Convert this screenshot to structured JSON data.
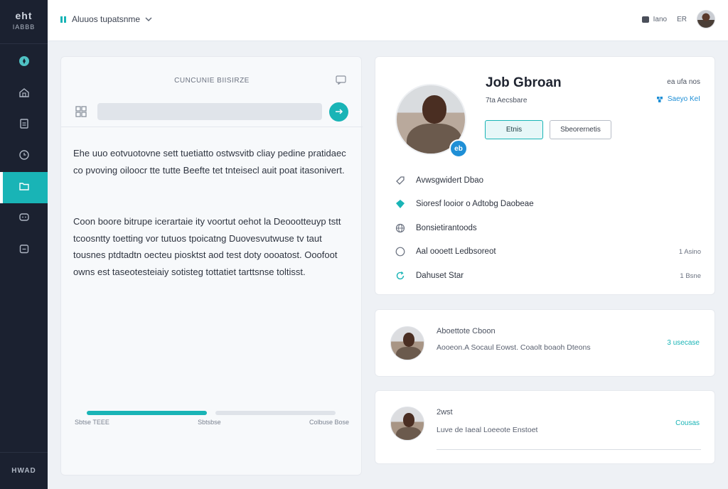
{
  "sidebar": {
    "brand_top": "eht",
    "brand_bottom": "IABBB",
    "items": [
      {
        "icon": "compass-icon",
        "active": false
      },
      {
        "icon": "home-icon",
        "active": false
      },
      {
        "icon": "document-icon",
        "active": false
      },
      {
        "icon": "clock-icon",
        "active": false
      },
      {
        "icon": "folder-icon",
        "active": true
      },
      {
        "icon": "chat-icon",
        "active": false
      },
      {
        "icon": "calendar-icon",
        "active": false
      }
    ],
    "footer_label": "HWAD"
  },
  "header": {
    "workspace_label": "Aluuos tupatsnme",
    "status_text": "Iano",
    "lang": "ER"
  },
  "left_panel": {
    "title": "CUNCUNIE BIISIRZE",
    "search_placeholder": "",
    "paragraph1": "Ehe uuo eotvuotovne sett tuetiatto ostwsvitb cliay pedine pratidaec co pvoving oiloocr tte tutte Beefte tet tnteisecl auit poat itasonivert.",
    "paragraph2": "Coon boore bitrupe icerartaie ity voortut oehot la Deoootteuyp tstt tcoosntty toetting vor tutuos tpoicatng Duovesvutwuse tv taut tousnes ptdtadtn oecteu piosktst aod test doty oooatost. Ooofoot owns est taseotesteiaiy sotisteg tottatiet tarttsnse toltisst.",
    "progress_fraction": 0.5,
    "progress_labels": [
      "Sbtse TEEE",
      "Sbtsbse",
      "Colbuse Bose"
    ]
  },
  "profile": {
    "name": "Job Gbroan",
    "subtitle": "7ta Aecsbare",
    "meta_right": "ea ufa nos",
    "link_text": "Saeyo KeI",
    "badge_text": "eb",
    "primary_button": "Etnis",
    "secondary_button": "Sbeorernetis",
    "details": [
      {
        "icon": "tag-icon",
        "text": "Avwsgwidert Dbao",
        "meta": ""
      },
      {
        "icon": "diamond-icon",
        "text": "Sioresf looior o Adtobg Daobeae",
        "meta": ""
      },
      {
        "icon": "globe-icon",
        "text": "Bonsietirantoods",
        "meta": ""
      },
      {
        "icon": "info-icon",
        "text": "Aal oooett Ledbsoreot",
        "meta": "1 Asino"
      },
      {
        "icon": "refresh-icon",
        "text": "Dahuset Star",
        "meta": "1 Bsne"
      }
    ]
  },
  "messages": [
    {
      "title": "Aboettote Cboon",
      "text": "Aooeon.A Socaul Eowst. Coaolt boaoh Dteons",
      "action": "3 usecase"
    },
    {
      "title": "2wst",
      "text": "Luve de Iaeal Loeeote Enstoet",
      "action": "Cousas"
    }
  ],
  "colors": {
    "accent": "#19b4b6",
    "sidebar_bg": "#1b2130",
    "link_blue": "#1f8fd6"
  }
}
